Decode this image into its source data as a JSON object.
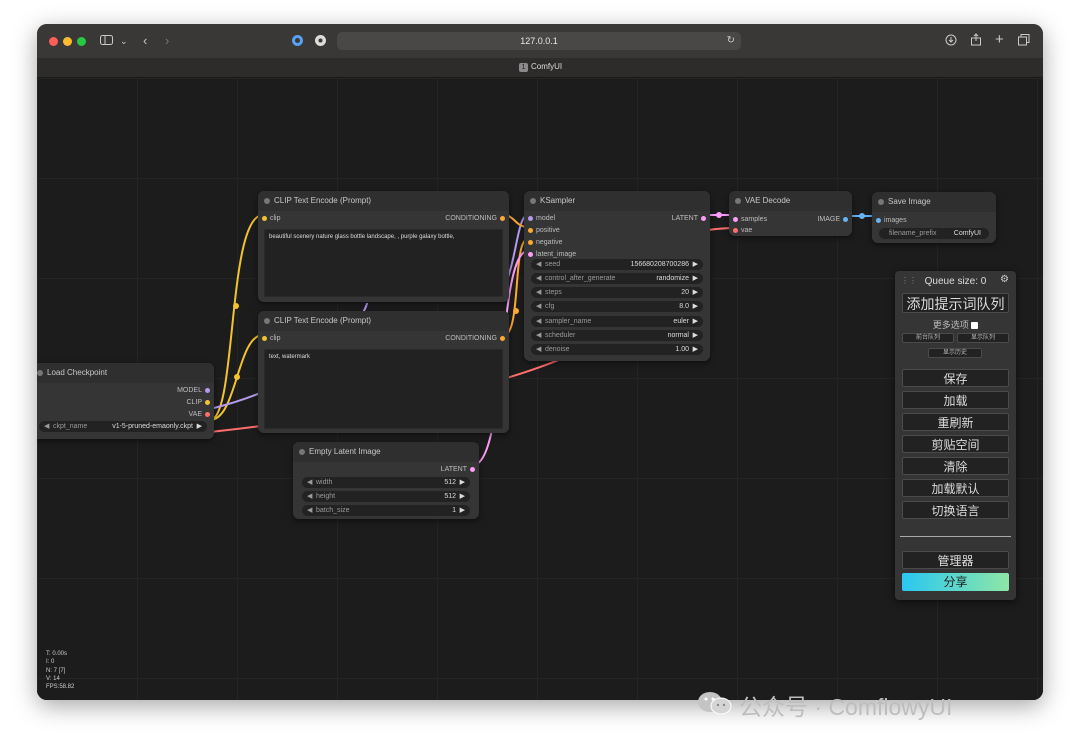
{
  "browser": {
    "url": "127.0.0.1",
    "tab_number": "1",
    "tab_title": "ComfyUI"
  },
  "nodes": {
    "clip_pos": {
      "title": "CLIP Text Encode (Prompt)",
      "input": "clip",
      "output": "CONDITIONING",
      "text": "beautiful scenery nature glass bottle landscape, , purple galaxy bottle,"
    },
    "clip_neg": {
      "title": "CLIP Text Encode (Prompt)",
      "input": "clip",
      "output": "CONDITIONING",
      "text": "text, watermark"
    },
    "ksampler": {
      "title": "KSampler",
      "inputs": [
        "model",
        "positive",
        "negative",
        "latent_image"
      ],
      "output": "LATENT",
      "widgets": [
        {
          "label": "seed",
          "value": "156680208700286"
        },
        {
          "label": "control_after_generate",
          "value": "randomize"
        },
        {
          "label": "steps",
          "value": "20"
        },
        {
          "label": "cfg",
          "value": "8.0"
        },
        {
          "label": "sampler_name",
          "value": "euler"
        },
        {
          "label": "scheduler",
          "value": "normal"
        },
        {
          "label": "denoise",
          "value": "1.00"
        }
      ]
    },
    "vae_decode": {
      "title": "VAE Decode",
      "inputs": [
        "samples",
        "vae"
      ],
      "output": "IMAGE"
    },
    "save_image": {
      "title": "Save Image",
      "input": "images",
      "widget": {
        "label": "filename_prefix",
        "value": "ComfyUI"
      }
    },
    "load_checkpoint": {
      "title": "Load Checkpoint",
      "outputs": [
        "MODEL",
        "CLIP",
        "VAE"
      ],
      "widget": {
        "label": "ckpt_name",
        "value": "v1-5-pruned-emaonly.ckpt"
      }
    },
    "empty_latent": {
      "title": "Empty Latent Image",
      "output": "LATENT",
      "widgets": [
        {
          "label": "width",
          "value": "512"
        },
        {
          "label": "height",
          "value": "512"
        },
        {
          "label": "batch_size",
          "value": "1"
        }
      ]
    }
  },
  "menu": {
    "queue_size": "Queue size: 0",
    "queue_prompt": "添加提示词队列",
    "extra_options": "更多选项",
    "view_queue_front": "前台队列",
    "view_queue": "显示队列",
    "view_history": "显示历史",
    "save": "保存",
    "load": "加载",
    "refresh": "重刷新",
    "clipspace": "剪贴空间",
    "clear": "清除",
    "load_default": "加载默认",
    "switch_language": "切换语言",
    "manager": "管理器",
    "share": "分享"
  },
  "stats": {
    "t": "T: 0.00s",
    "i": "I: 0",
    "n": "N: 7 [7]",
    "v": "V: 14",
    "fps": "FPS:58.82"
  },
  "watermark": "公众号 · ComflowyUI",
  "link_colors": {
    "clip": "#f2c230",
    "model": "#b59af0",
    "vae": "#ff6e6e",
    "conditioning": "#ffa931",
    "latent": "#ff9cf9",
    "image": "#64b5f6"
  }
}
